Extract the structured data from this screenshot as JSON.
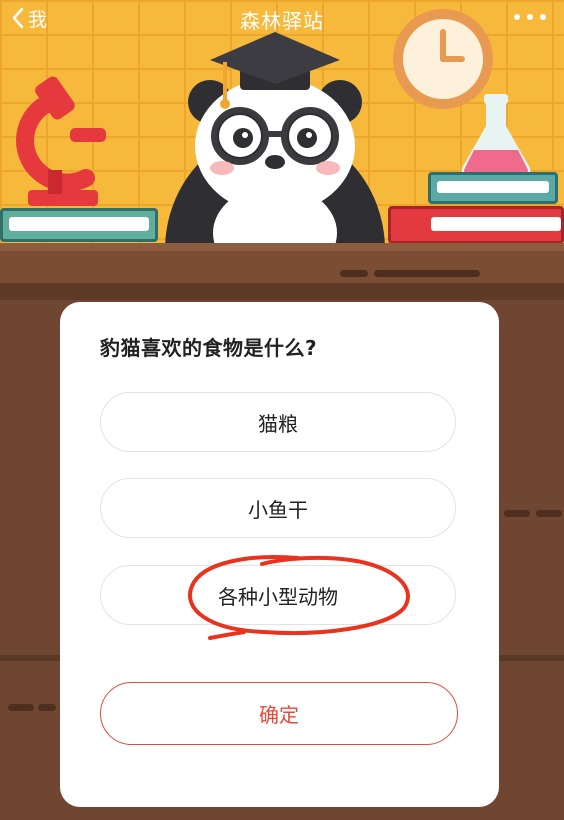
{
  "topbar": {
    "back_label": "我",
    "title": "森林驿站"
  },
  "quiz": {
    "question": "豹猫喜欢的食物是什么?",
    "options": [
      "猫粮",
      "小鱼干",
      "各种小型动物"
    ],
    "confirm_label": "确定",
    "highlighted_option_index": 2
  },
  "colors": {
    "wall": "#f7b93c",
    "wood": "#6e4631",
    "accent": "#e24a3b",
    "card": "#ffffff"
  }
}
